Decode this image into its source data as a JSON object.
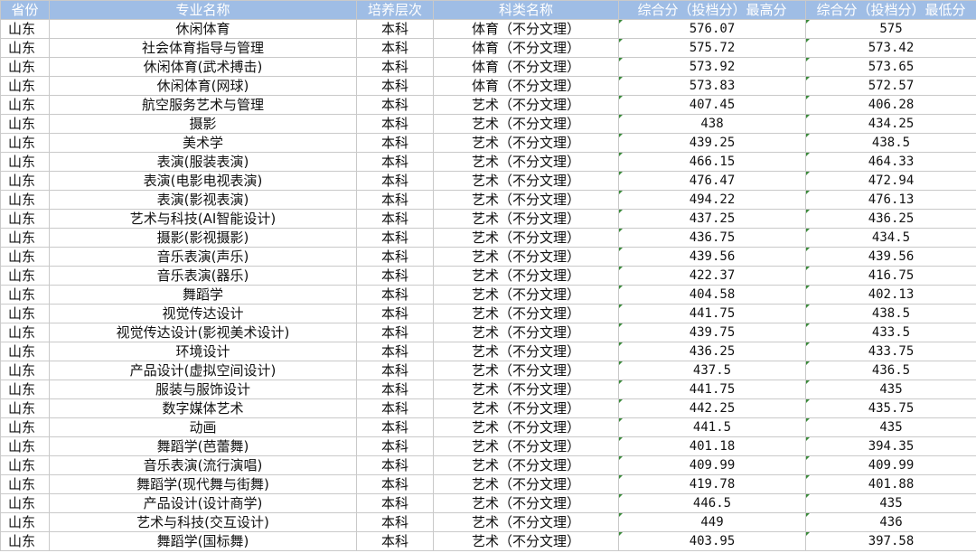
{
  "headers": [
    "省份",
    "专业名称",
    "培养层次",
    "科类名称",
    "综合分（投档分）最高分",
    "综合分（投档分）最低分"
  ],
  "rows": [
    [
      "山东",
      "休闲体育",
      "本科",
      "体育（不分文理）",
      "576.07",
      "575"
    ],
    [
      "山东",
      "社会体育指导与管理",
      "本科",
      "体育（不分文理）",
      "575.72",
      "573.42"
    ],
    [
      "山东",
      "休闲体育(武术搏击)",
      "本科",
      "体育（不分文理）",
      "573.92",
      "573.65"
    ],
    [
      "山东",
      "休闲体育(网球)",
      "本科",
      "体育（不分文理）",
      "573.83",
      "572.57"
    ],
    [
      "山东",
      "航空服务艺术与管理",
      "本科",
      "艺术（不分文理）",
      "407.45",
      "406.28"
    ],
    [
      "山东",
      "摄影",
      "本科",
      "艺术（不分文理）",
      "438",
      "434.25"
    ],
    [
      "山东",
      "美术学",
      "本科",
      "艺术（不分文理）",
      "439.25",
      "438.5"
    ],
    [
      "山东",
      "表演(服装表演)",
      "本科",
      "艺术（不分文理）",
      "466.15",
      "464.33"
    ],
    [
      "山东",
      "表演(电影电视表演)",
      "本科",
      "艺术（不分文理）",
      "476.47",
      "472.94"
    ],
    [
      "山东",
      "表演(影视表演)",
      "本科",
      "艺术（不分文理）",
      "494.22",
      "476.13"
    ],
    [
      "山东",
      "艺术与科技(AI智能设计)",
      "本科",
      "艺术（不分文理）",
      "437.25",
      "436.25"
    ],
    [
      "山东",
      "摄影(影视摄影)",
      "本科",
      "艺术（不分文理）",
      "436.75",
      "434.5"
    ],
    [
      "山东",
      "音乐表演(声乐)",
      "本科",
      "艺术（不分文理）",
      "439.56",
      "439.56"
    ],
    [
      "山东",
      "音乐表演(器乐)",
      "本科",
      "艺术（不分文理）",
      "422.37",
      "416.75"
    ],
    [
      "山东",
      "舞蹈学",
      "本科",
      "艺术（不分文理）",
      "404.58",
      "402.13"
    ],
    [
      "山东",
      "视觉传达设计",
      "本科",
      "艺术（不分文理）",
      "441.75",
      "438.5"
    ],
    [
      "山东",
      "视觉传达设计(影视美术设计)",
      "本科",
      "艺术（不分文理）",
      "439.75",
      "433.5"
    ],
    [
      "山东",
      "环境设计",
      "本科",
      "艺术（不分文理）",
      "436.25",
      "433.75"
    ],
    [
      "山东",
      "产品设计(虚拟空间设计)",
      "本科",
      "艺术（不分文理）",
      "437.5",
      "436.5"
    ],
    [
      "山东",
      "服装与服饰设计",
      "本科",
      "艺术（不分文理）",
      "441.75",
      "435"
    ],
    [
      "山东",
      "数字媒体艺术",
      "本科",
      "艺术（不分文理）",
      "442.25",
      "435.75"
    ],
    [
      "山东",
      "动画",
      "本科",
      "艺术（不分文理）",
      "441.5",
      "435"
    ],
    [
      "山东",
      "舞蹈学(芭蕾舞)",
      "本科",
      "艺术（不分文理）",
      "401.18",
      "394.35"
    ],
    [
      "山东",
      "音乐表演(流行演唱)",
      "本科",
      "艺术（不分文理）",
      "409.99",
      "409.99"
    ],
    [
      "山东",
      "舞蹈学(现代舞与街舞)",
      "本科",
      "艺术（不分文理）",
      "419.78",
      "401.88"
    ],
    [
      "山东",
      "产品设计(设计商学)",
      "本科",
      "艺术（不分文理）",
      "446.5",
      "435"
    ],
    [
      "山东",
      "艺术与科技(交互设计)",
      "本科",
      "艺术（不分文理）",
      "449",
      "436"
    ],
    [
      "山东",
      "舞蹈学(国标舞)",
      "本科",
      "艺术（不分文理）",
      "403.95",
      "397.58"
    ]
  ]
}
